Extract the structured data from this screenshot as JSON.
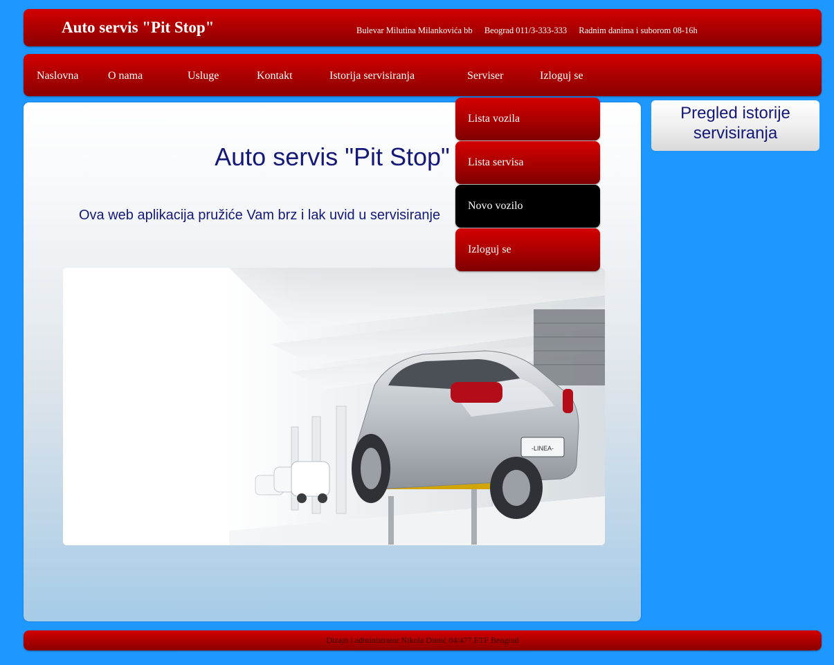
{
  "header": {
    "title": "Auto servis \"Pit Stop\"",
    "address": "Bulevar Milutina Milankovića bb",
    "phone": "Beograd 011/3-333-333",
    "hours": "Radnim danima i suborom 08-16h"
  },
  "nav": {
    "items": [
      {
        "label": "Naslovna"
      },
      {
        "label": "O nama"
      },
      {
        "label": "Usluge"
      },
      {
        "label": "Kontakt"
      },
      {
        "label": "Istorija servisiranja"
      },
      {
        "label": "Serviser"
      },
      {
        "label": "Izloguj se"
      }
    ]
  },
  "dropdown": {
    "items": [
      {
        "label": "Lista vozila"
      },
      {
        "label": "Lista servisa"
      },
      {
        "label": "Novo vozilo",
        "active": true
      },
      {
        "label": "Izloguj se"
      }
    ]
  },
  "main": {
    "heading": "Auto servis \"Pit Stop\"",
    "intro": "Ova web aplikacija pružiće Vam brz i lak uvid u servisiranje"
  },
  "sidebar": {
    "box_label_line1": "Pregled istorije",
    "box_label_line2": "servisiranja"
  },
  "footer": {
    "text": "Dizajn i administrator Nikola Dimić 04/477 ETF Beograd"
  },
  "colors": {
    "background": "#1e98ff",
    "bar_red": "#c00000",
    "heading_navy": "#141877",
    "active_item": "#000000"
  }
}
